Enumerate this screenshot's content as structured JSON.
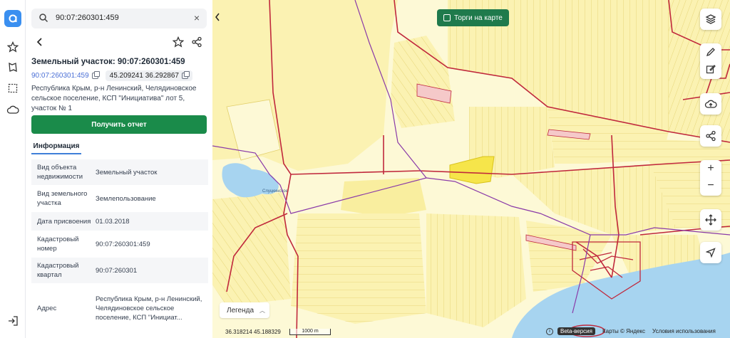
{
  "search": {
    "value": "90:07:260301:459"
  },
  "panel": {
    "title": "Земельный участок: 90:07:260301:459",
    "cad_link": "90:07:260301:459",
    "coords": "45.209241 36.292867",
    "address": "Республика Крым, р-н Ленинский, Челядиновское сельское поселение, КСП \"Инициатива\" лот 5, участок № 1",
    "report_button": "Получить отчет",
    "tab": "Информация",
    "rows": [
      {
        "k": "Вид объекта недвижимости",
        "v": "Земельный участок"
      },
      {
        "k": "Вид земельного участка",
        "v": "Землепользование"
      },
      {
        "k": "Дата присвоения",
        "v": "01.03.2018"
      },
      {
        "k": "Кадастровый номер",
        "v": "90:07:260301:459"
      },
      {
        "k": "Кадастровый квартал",
        "v": "90:07:260301"
      },
      {
        "k": "Адрес",
        "v": "Республика Крым, р-н Ленинский, Челядиновское сельское поселение, КСП \"Инициат..."
      }
    ]
  },
  "map": {
    "torgi_label": "Торги на карте",
    "legend_label": "Легенда",
    "lake_label": "Слуцкинское",
    "coords_readout": "36.318214  45.188329",
    "scale_label": "1000 m",
    "beta": "Beta-версия",
    "maps_credit": "Карты © Яндекс",
    "terms": "Условия использования",
    "zoom_in": "+",
    "zoom_out": "−"
  },
  "colors": {
    "accent_green": "#1a8b4a",
    "link_blue": "#4a6fd6",
    "parcel_border": "#c0283c",
    "parcel_fill": "#fbf2b2",
    "water": "#a7d4f0"
  }
}
